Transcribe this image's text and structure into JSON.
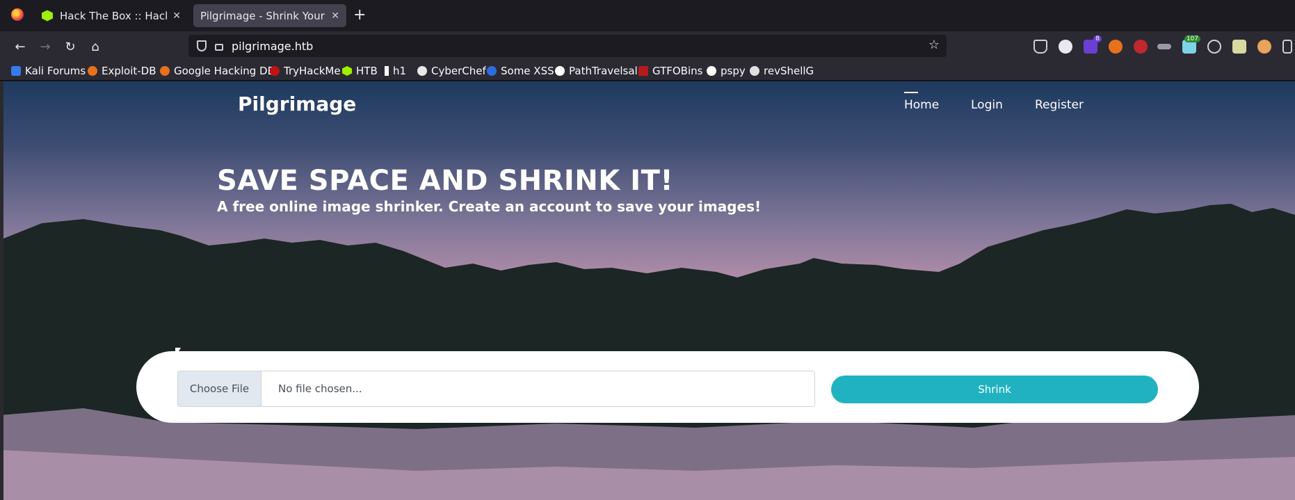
{
  "browser": {
    "tabs": [
      {
        "title": "Hack The Box :: Hack The Box",
        "active": false,
        "icon": "htb-cube-icon"
      },
      {
        "title": "Pilgrimage - Shrink Your Images",
        "active": true,
        "icon": "none"
      }
    ],
    "new_tab": "+",
    "close_glyph": "✕",
    "url": "pilgrimage.htb",
    "extension_badges": {
      "ext1": "8",
      "ext2": "107"
    },
    "bookmarks": [
      {
        "label": "Kali Forums",
        "icon": "kali-icon",
        "color": "#367bf0"
      },
      {
        "label": "Exploit-DB",
        "icon": "exploitdb-icon",
        "color": "#e8711d"
      },
      {
        "label": "Google Hacking DB",
        "icon": "ghdb-icon",
        "color": "#e8711d"
      },
      {
        "label": "TryHackMe",
        "icon": "tryhackme-icon",
        "color": "#c11111"
      },
      {
        "label": "HTB",
        "icon": "htb-icon",
        "color": "#9fef00"
      },
      {
        "label": "h1",
        "icon": "hackerone-icon",
        "color": "#ffffff"
      },
      {
        "label": "CyberChef",
        "icon": "cyberchef-icon",
        "color": "#e8e8e8"
      },
      {
        "label": "Some XSS",
        "icon": "xss-icon",
        "color": "#2a6fdb"
      },
      {
        "label": "PathTravelsal",
        "icon": "github-icon",
        "color": "#ffffff"
      },
      {
        "label": "GTFOBins",
        "icon": "gtfobins-icon",
        "color": "#b31b1b"
      },
      {
        "label": "pspy",
        "icon": "github-icon",
        "color": "#ffffff"
      },
      {
        "label": "revShellG",
        "icon": "skull-icon",
        "color": "#e0e0e0"
      }
    ]
  },
  "site": {
    "brand": "Pilgrimage",
    "menu": {
      "home": "Home",
      "login": "Login",
      "register": "Register"
    },
    "hero": {
      "title": "SAVE SPACE AND SHRINK IT!",
      "subtitle": "A free online image shrinker. Create an account to save your images!"
    },
    "upload": {
      "choose_label": "Choose File",
      "placeholder": "No file chosen...",
      "submit_label": "Shrink"
    }
  },
  "colors": {
    "accent": "#20b2c0",
    "sky_top": "#1e3a5f",
    "sky_bottom": "#dca8ba",
    "mountain": "#1c2625"
  }
}
